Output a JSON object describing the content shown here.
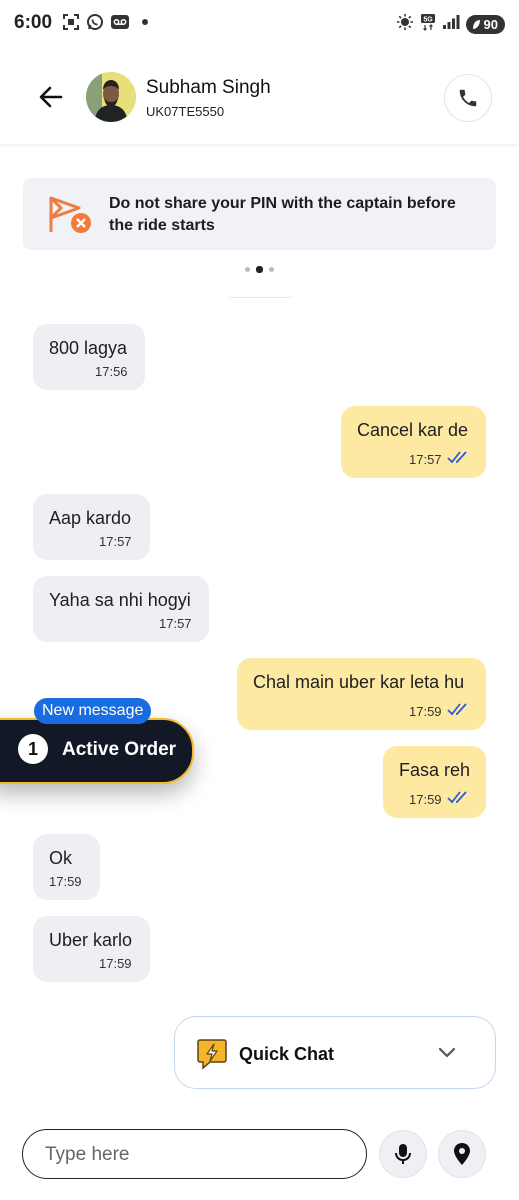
{
  "status_bar": {
    "time": "6:00",
    "left_icons": [
      "screenshot-icon",
      "whatsapp-icon",
      "voicemail-icon"
    ],
    "right_icons": [
      "brightness-icon",
      "5g-icon",
      "signal-icon"
    ],
    "battery": "90"
  },
  "header": {
    "name": "Subham Singh",
    "vehicle_number": "UK07TE5550"
  },
  "banner": {
    "text": "Do not share your PIN with the captain before the ride starts",
    "page_count": 3,
    "active_page": 2
  },
  "messages": [
    {
      "side": "incoming",
      "text": "800 lagya",
      "time": "17:56"
    },
    {
      "side": "outgoing",
      "text": "Cancel kar de",
      "time": "17:57",
      "read": true
    },
    {
      "side": "incoming",
      "text": "Aap kardo",
      "time": "17:57"
    },
    {
      "side": "incoming",
      "text": "Yaha sa nhi hogyi",
      "time": "17:57"
    },
    {
      "side": "outgoing",
      "text": "Chal main uber kar leta hu",
      "time": "17:59",
      "read": true
    },
    {
      "side": "outgoing",
      "text": "Fasa reh",
      "time": "17:59",
      "read": true
    },
    {
      "side": "incoming",
      "text": "Ok",
      "time": "17:59"
    },
    {
      "side": "incoming",
      "text": "Uber karlo",
      "time": "17:59"
    }
  ],
  "new_message_label": "New message",
  "active_order": {
    "count": "1",
    "label": "Active Order"
  },
  "quick_chat": {
    "label": "Quick Chat"
  },
  "input": {
    "placeholder": "Type here",
    "value": ""
  },
  "colors": {
    "incoming_bubble": "#eeeff2",
    "outgoing_bubble": "#fde9a2",
    "read_ticks": "#2a5bd7",
    "active_order_bg": "#121826",
    "active_order_border": "#f3bb2a",
    "new_message_badge": "#1a6de0",
    "banner_icon": "#f07b3f"
  }
}
